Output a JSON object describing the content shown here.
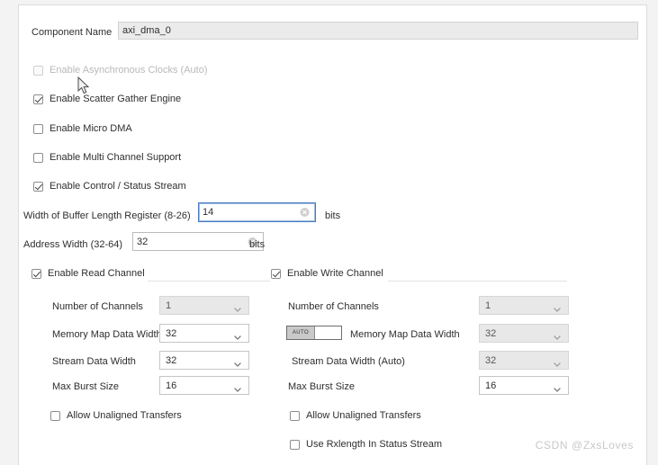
{
  "dialog": {
    "component_name_label": "Component Name",
    "component_name_value": "axi_dma_0"
  },
  "options": [
    {
      "label": "Enable Asynchronous Clocks (Auto)",
      "checked": false,
      "disabled": true
    },
    {
      "label": "Enable Scatter Gather Engine",
      "checked": true,
      "disabled": false
    },
    {
      "label": "Enable Micro DMA",
      "checked": false,
      "disabled": false
    },
    {
      "label": "Enable Multi Channel Support",
      "checked": false,
      "disabled": false
    },
    {
      "label": "Enable Control / Status Stream",
      "checked": true,
      "disabled": false
    }
  ],
  "buffer_length": {
    "label": "Width of Buffer Length Register (8-26)",
    "value": "14",
    "unit": "bits",
    "clear_icon": "clear-circle-icon"
  },
  "address_width": {
    "label": "Address Width (32-64)",
    "value": "32",
    "unit": "bits",
    "clear_icon": "clear-circle-icon"
  },
  "read_channel": {
    "title": "Enable Read Channel",
    "checked": true,
    "fields": [
      {
        "label": "Number of Channels",
        "value": "1",
        "disabled": true
      },
      {
        "label": "Memory Map Data Width",
        "value": "32",
        "disabled": false
      },
      {
        "label": "Stream Data Width",
        "value": "32",
        "disabled": false
      },
      {
        "label": "Max Burst Size",
        "value": "16",
        "disabled": false
      }
    ],
    "checkboxes": [
      {
        "label": "Allow Unaligned Transfers",
        "checked": false
      }
    ]
  },
  "write_channel": {
    "title": "Enable Write Channel",
    "checked": true,
    "auto_toggle_label": "AUTO",
    "fields": [
      {
        "label": "Number of Channels",
        "value": "1",
        "disabled": true
      },
      {
        "label": "Memory Map Data Width",
        "value": "32",
        "disabled": true
      },
      {
        "label": "Stream Data Width (Auto)",
        "value": "32",
        "disabled": true
      },
      {
        "label": "Max Burst Size",
        "value": "16",
        "disabled": false
      }
    ],
    "checkboxes": [
      {
        "label": "Allow Unaligned Transfers",
        "checked": false
      },
      {
        "label": "Use Rxlength In Status Stream",
        "checked": false
      }
    ]
  },
  "watermark": "CSDN @ZxsLoves",
  "colors": {
    "focus_border": "#4a7cc0",
    "panel_bg": "#ffffff",
    "field_bg": "#ebebeb",
    "disabled_text": "#b4b4b4"
  }
}
